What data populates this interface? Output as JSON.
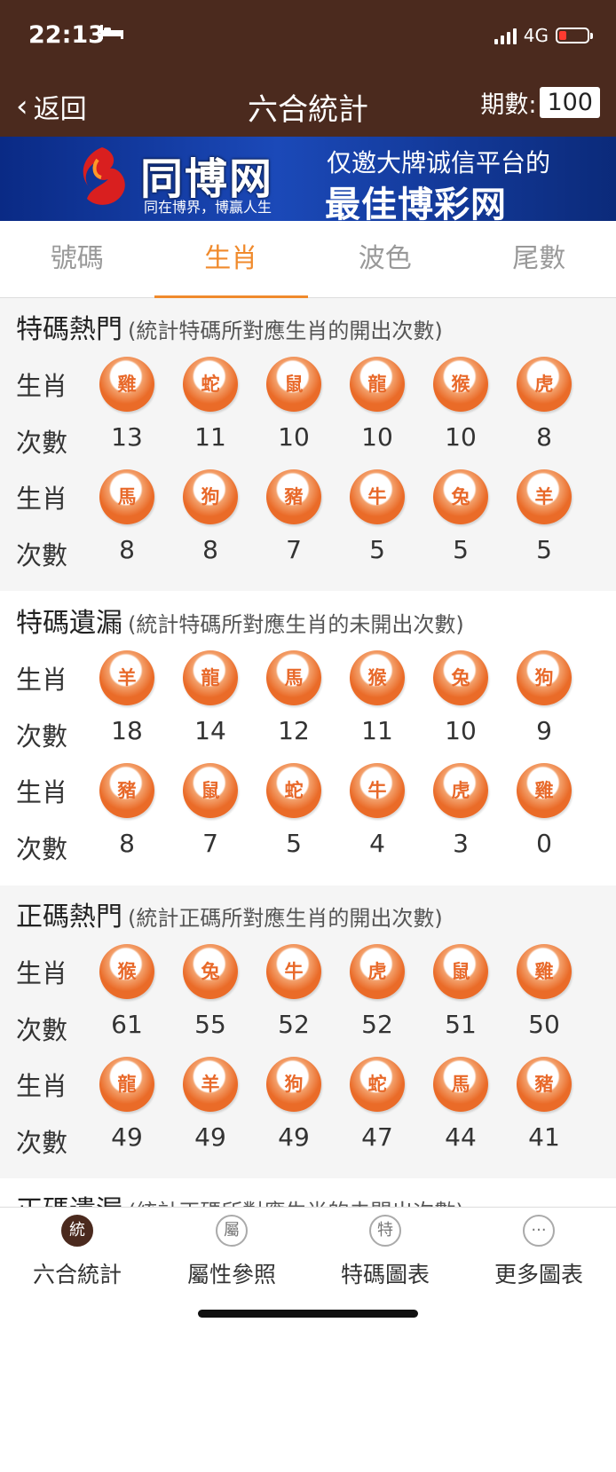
{
  "status_bar": {
    "time": "22:13",
    "network": "4G"
  },
  "nav": {
    "back_label": "返回",
    "title": "六合統計",
    "period_label": "期數:",
    "period_value": "100"
  },
  "banner": {
    "logo": "同博网",
    "slogan": "同在博界，博赢人生",
    "line1": "仅邀大牌诚信平台的",
    "line2": "最佳博彩网"
  },
  "tabs": [
    {
      "label": "號碼",
      "active": false
    },
    {
      "label": "生肖",
      "active": true
    },
    {
      "label": "波色",
      "active": false
    },
    {
      "label": "尾數",
      "active": false
    }
  ],
  "row_labels": {
    "zodiac": "生肖",
    "count": "次數"
  },
  "sections": [
    {
      "title": "特碼熱門",
      "subtitle": "(統計特碼所對應生肖的開出次數)",
      "rows": [
        {
          "zodiacs": [
            "雞",
            "蛇",
            "鼠",
            "龍",
            "猴",
            "虎"
          ],
          "counts": [
            "13",
            "11",
            "10",
            "10",
            "10",
            "8"
          ]
        },
        {
          "zodiacs": [
            "馬",
            "狗",
            "豬",
            "牛",
            "兔",
            "羊"
          ],
          "counts": [
            "8",
            "8",
            "7",
            "5",
            "5",
            "5"
          ]
        }
      ]
    },
    {
      "title": "特碼遺漏",
      "subtitle": "(統計特碼所對應生肖的未開出次數)",
      "rows": [
        {
          "zodiacs": [
            "羊",
            "龍",
            "馬",
            "猴",
            "兔",
            "狗"
          ],
          "counts": [
            "18",
            "14",
            "12",
            "11",
            "10",
            "9"
          ]
        },
        {
          "zodiacs": [
            "豬",
            "鼠",
            "蛇",
            "牛",
            "虎",
            "雞"
          ],
          "counts": [
            "8",
            "7",
            "5",
            "4",
            "3",
            "0"
          ]
        }
      ]
    },
    {
      "title": "正碼熱門",
      "subtitle": "(統計正碼所對應生肖的開出次數)",
      "rows": [
        {
          "zodiacs": [
            "猴",
            "兔",
            "牛",
            "虎",
            "鼠",
            "雞"
          ],
          "counts": [
            "61",
            "55",
            "52",
            "52",
            "51",
            "50"
          ]
        },
        {
          "zodiacs": [
            "龍",
            "羊",
            "狗",
            "蛇",
            "馬",
            "豬"
          ],
          "counts": [
            "49",
            "49",
            "49",
            "47",
            "44",
            "41"
          ]
        }
      ]
    },
    {
      "title": "正碼遺漏",
      "subtitle": "(統計正碼所對應生肖的未開出次數)",
      "rows": []
    }
  ],
  "bottom_nav": [
    {
      "icon_char": "統",
      "label": "六合統計",
      "active": true
    },
    {
      "icon_char": "屬",
      "label": "屬性參照",
      "active": false
    },
    {
      "icon_char": "特",
      "label": "特碼圖表",
      "active": false
    },
    {
      "icon_char": "···",
      "label": "更多圖表",
      "active": false
    }
  ],
  "colors": {
    "header_bg": "#4b2a1e",
    "accent": "#f08a2c",
    "ball": "#ea6b28"
  }
}
